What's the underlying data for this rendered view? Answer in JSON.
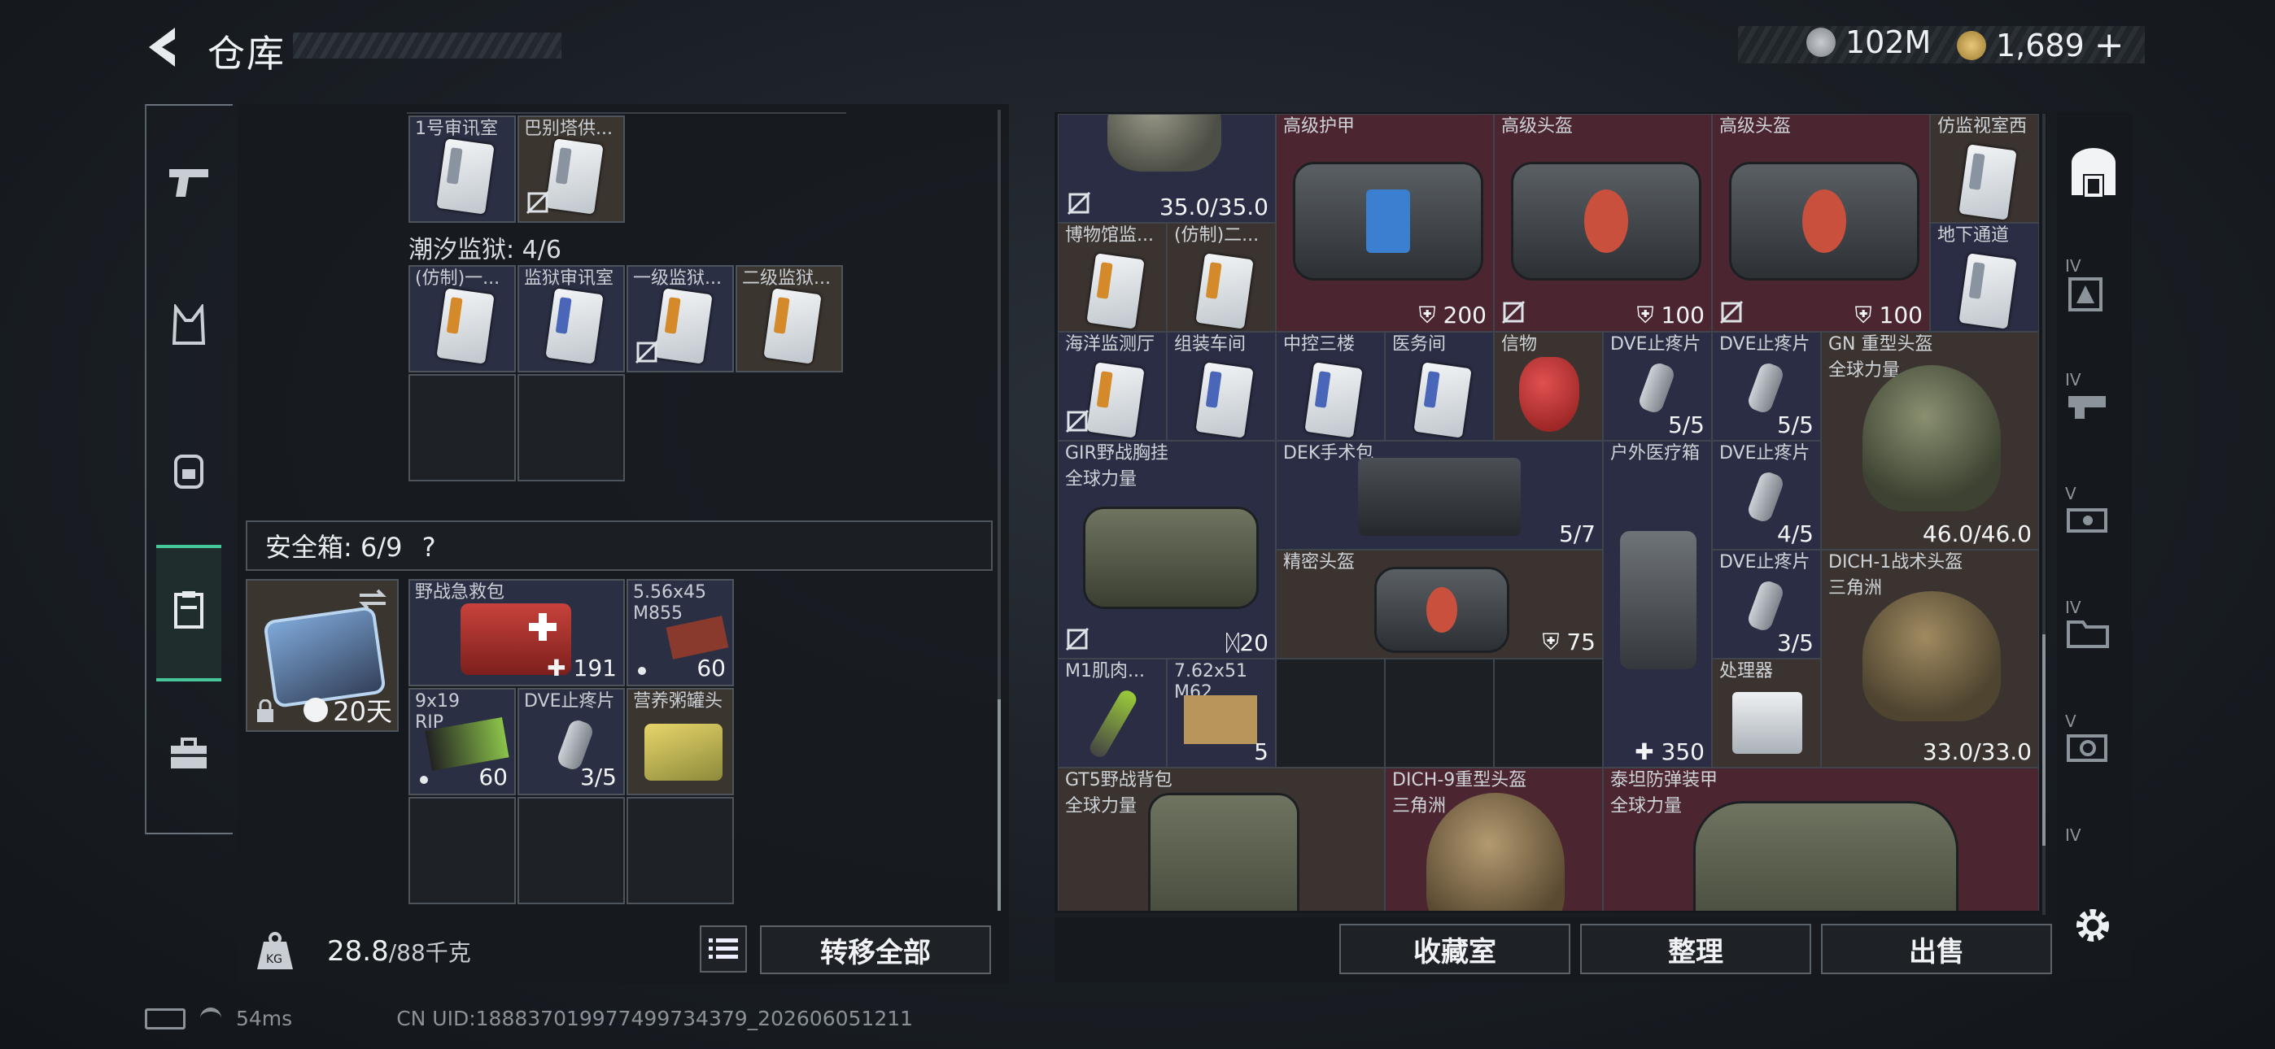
{
  "header": {
    "title": "仓库"
  },
  "currency": {
    "silver": "102M",
    "gold": "1,689",
    "add_symbol": "+"
  },
  "left": {
    "row1": [
      "1号审讯室",
      "巴别塔供..."
    ],
    "section1": "潮汐监狱: 4/6",
    "row2": [
      "(仿制)一...",
      "监狱审讯室",
      "一级监狱...",
      "二级监狱..."
    ],
    "safebox_label": "安全箱: 6/9",
    "safebox_help": "?",
    "safebox_days": "20天",
    "items": [
      {
        "label": "野战急救包",
        "value": "191"
      },
      {
        "label": "5.56x45",
        "label2": "M855",
        "value": "60"
      },
      {
        "label": "9x19",
        "label2": "RIP",
        "value": "60"
      },
      {
        "label": "DVE止疼片",
        "value": "3/5"
      },
      {
        "label": "营养粥罐头",
        "value": ""
      }
    ],
    "weight_value": "28.8",
    "weight_max": "/88千克",
    "transfer_all": "转移全部"
  },
  "right": {
    "cells": [
      {
        "label": "",
        "value": "35.0/35.0"
      },
      {
        "label": "高级护甲",
        "value": "200"
      },
      {
        "label": "高级头盔",
        "value": "100"
      },
      {
        "label": "高级头盔",
        "value": "100"
      },
      {
        "label": "仿监视室西",
        "value": ""
      },
      {
        "label": "博物馆监...",
        "value": ""
      },
      {
        "label": "(仿制)二...",
        "value": ""
      },
      {
        "label": "地下通道",
        "value": ""
      },
      {
        "label": "海洋监测厅",
        "value": ""
      },
      {
        "label": "组装车间",
        "value": ""
      },
      {
        "label": "中控三楼",
        "value": ""
      },
      {
        "label": "医务间",
        "value": ""
      },
      {
        "label": "信物",
        "value": ""
      },
      {
        "label": "DVE止疼片",
        "value": "5/5"
      },
      {
        "label": "DVE止疼片",
        "value": "5/5"
      },
      {
        "label": "GN 重型头盔",
        "label2": "全球力量",
        "value": "46.0/46.0"
      },
      {
        "label": "GIR野战胸挂",
        "label2": "全球力量",
        "value": "20"
      },
      {
        "label": "DEK手术包",
        "value": "5/7"
      },
      {
        "label": "户外医疗箱",
        "value": "350"
      },
      {
        "label": "DVE止疼片",
        "value": "4/5"
      },
      {
        "label": "精密头盔",
        "value": "75"
      },
      {
        "label": "DVE止疼片",
        "value": "3/5"
      },
      {
        "label": "DICH-1战术头盔",
        "label2": "三角洲",
        "value": "33.0/33.0"
      },
      {
        "label": "M1肌肉...",
        "value": ""
      },
      {
        "label": "7.62x51",
        "label2": "M62",
        "value": "5"
      },
      {
        "label": "处理器",
        "value": ""
      },
      {
        "label": "GT5野战背包",
        "label2": "全球力量",
        "value": ""
      },
      {
        "label": "DICH-9重型头盔",
        "label2": "三角洲",
        "value": ""
      },
      {
        "label": "泰坦防弹装甲",
        "label2": "全球力量",
        "value": ""
      }
    ],
    "buttons": [
      "收藏室",
      "整理",
      "出售"
    ]
  },
  "rail": {
    "tier_labels": [
      "IV",
      "IV",
      "V",
      "IV",
      "V",
      "IV"
    ]
  },
  "footer": {
    "ping": "54ms",
    "uid": "CN UID:18883701997749973437​9_202606051211"
  },
  "colors": {
    "accent": "#45c79a",
    "red_cell": "#4b2530",
    "blue_cell": "#2b2d44",
    "brown_cell": "#3a3330"
  }
}
